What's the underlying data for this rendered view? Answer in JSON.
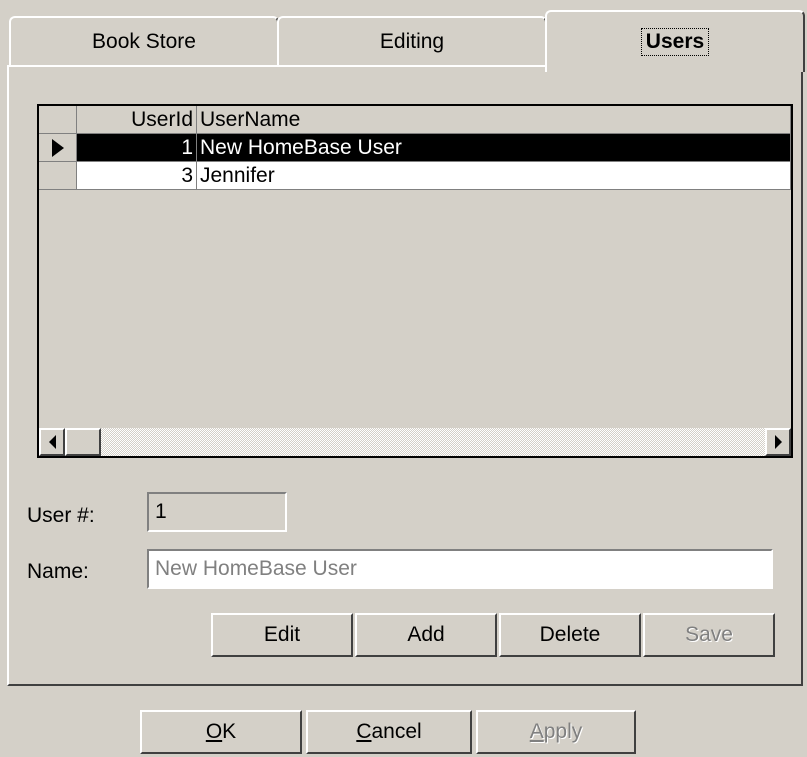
{
  "tabs": [
    {
      "label": "Book Store"
    },
    {
      "label": "Editing"
    },
    {
      "label": "Users"
    }
  ],
  "grid": {
    "columns": [
      "UserId",
      "UserName"
    ],
    "rows": [
      {
        "id": "1",
        "name": "New HomeBase User",
        "selected": true
      },
      {
        "id": "3",
        "name": "Jennifer",
        "selected": false
      }
    ]
  },
  "form": {
    "user_num_label": "User #:",
    "user_num_value": "1",
    "name_label": "Name:",
    "name_value": "New HomeBase User"
  },
  "actions": {
    "edit": "Edit",
    "add": "Add",
    "delete": "Delete",
    "save": "Save"
  },
  "dialog": {
    "ok_mnemonic": "O",
    "ok_rest": "K",
    "cancel_mnemonic": "C",
    "cancel_rest": "ancel",
    "apply_mnemonic": "A",
    "apply_rest": "pply"
  },
  "icons": {
    "row_selector": "right-triangle",
    "scroll_left": "left-arrow",
    "scroll_right": "right-arrow"
  },
  "colors": {
    "face": "#d4d0c8",
    "selected_row_bg": "#000000",
    "disabled_text": "#808080"
  }
}
